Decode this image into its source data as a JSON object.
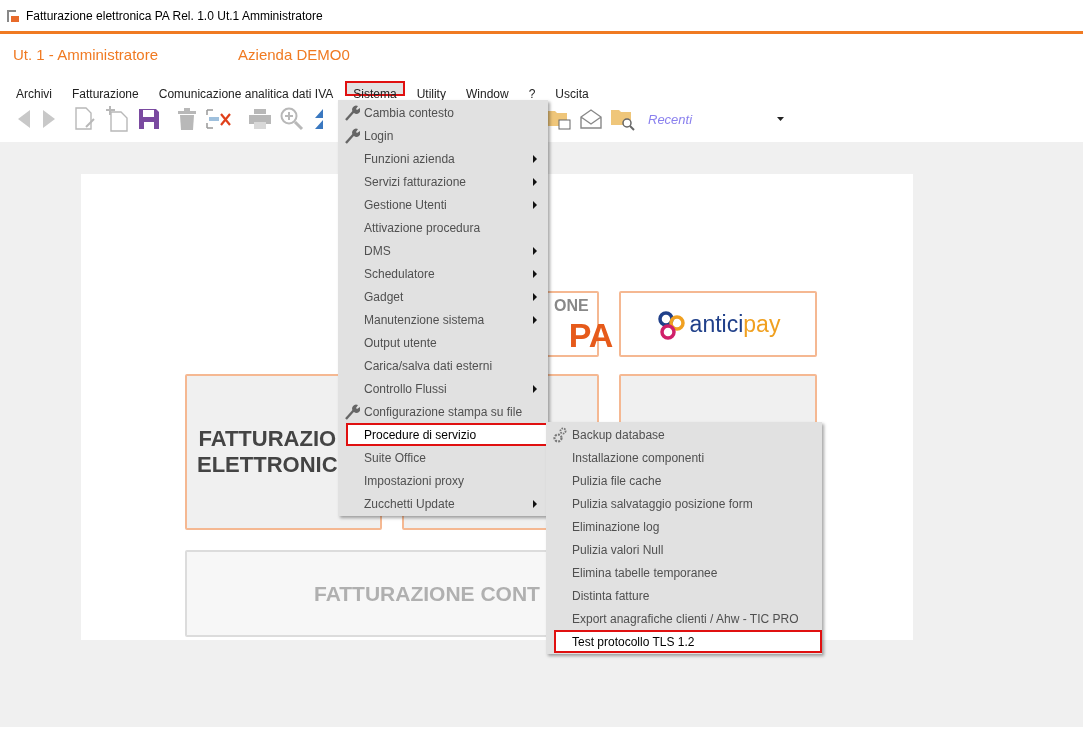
{
  "window": {
    "title": "Fatturazione elettronica PA Rel. 1.0 Ut.1 Amministratore"
  },
  "header": {
    "user": "Ut. 1 - Amministratore",
    "company": "Azienda DEMO0"
  },
  "menubar": [
    {
      "label": "Archivi",
      "selected": false
    },
    {
      "label": "Fatturazione",
      "selected": false
    },
    {
      "label": "Comunicazione analitica dati IVA",
      "selected": false
    },
    {
      "label": "Sistema",
      "selected": true
    },
    {
      "label": "Utility",
      "selected": false
    },
    {
      "label": "Window",
      "selected": false
    },
    {
      "label": "?",
      "selected": false
    },
    {
      "label": "Uscita",
      "selected": false
    }
  ],
  "toolbar": {
    "recent": {
      "placeholder": "Recenti"
    }
  },
  "tiles": [
    {
      "kind": "empty"
    },
    {
      "kind": "partial-logo",
      "lines": [
        "ONE",
        "PA"
      ]
    },
    {
      "kind": "anticipay",
      "words": [
        "antici",
        "pay"
      ]
    },
    {
      "kind": "title",
      "lines": [
        "FATTURAZIO",
        "ELETTRONIC"
      ]
    },
    {
      "kind": "blank"
    },
    {
      "kind": "blank"
    },
    {
      "kind": "wide-title",
      "lines": [
        "FATTURAZIONE CONT"
      ]
    }
  ],
  "menu": [
    {
      "label": "Cambia contesto",
      "kind": "wrench",
      "submenu": false,
      "selected": false
    },
    {
      "label": "Login",
      "kind": "wrench",
      "submenu": false,
      "selected": false
    },
    {
      "label": "Funzioni azienda",
      "kind": "plain",
      "submenu": true,
      "selected": false
    },
    {
      "label": "Servizi fatturazione",
      "kind": "plain",
      "submenu": true,
      "selected": false
    },
    {
      "label": "Gestione Utenti",
      "kind": "plain",
      "submenu": true,
      "selected": false
    },
    {
      "label": "Attivazione procedura",
      "kind": "plain",
      "submenu": false,
      "selected": false
    },
    {
      "label": "DMS",
      "kind": "plain",
      "submenu": true,
      "selected": false
    },
    {
      "label": "Schedulatore",
      "kind": "plain",
      "submenu": true,
      "selected": false
    },
    {
      "label": "Gadget",
      "kind": "plain",
      "submenu": true,
      "selected": false
    },
    {
      "label": "Manutenzione sistema",
      "kind": "plain",
      "submenu": true,
      "selected": false
    },
    {
      "label": "Output utente",
      "kind": "plain",
      "submenu": false,
      "selected": false
    },
    {
      "label": "Carica/salva dati esterni",
      "kind": "plain",
      "submenu": false,
      "selected": false
    },
    {
      "label": "Controllo Flussi",
      "kind": "plain",
      "submenu": true,
      "selected": false
    },
    {
      "label": "Configurazione stampa su file",
      "kind": "wrench",
      "submenu": false,
      "selected": false
    },
    {
      "label": "Procedure di servizio",
      "kind": "plain",
      "submenu": false,
      "selected": true
    },
    {
      "label": "Suite Office",
      "kind": "plain",
      "submenu": false,
      "selected": false
    },
    {
      "label": "Impostazioni proxy",
      "kind": "plain",
      "submenu": false,
      "selected": false
    },
    {
      "label": "Zucchetti Update",
      "kind": "plain",
      "submenu": true,
      "selected": false
    }
  ],
  "submenu": [
    {
      "label": "Backup database",
      "kind": "gear",
      "selected": false
    },
    {
      "label": "Installazione componenti",
      "kind": "plain",
      "selected": false
    },
    {
      "label": "Pulizia file cache",
      "kind": "plain",
      "selected": false
    },
    {
      "label": "Pulizia salvataggio posizione form",
      "kind": "plain",
      "selected": false
    },
    {
      "label": "Eliminazione log",
      "kind": "plain",
      "selected": false
    },
    {
      "label": "Pulizia valori Null",
      "kind": "plain",
      "selected": false
    },
    {
      "label": "Elimina tabelle temporanee",
      "kind": "plain",
      "selected": false
    },
    {
      "label": "Distinta fatture",
      "kind": "plain",
      "selected": false
    },
    {
      "label": "Export anagrafiche clienti / Ahw - TIC PRO",
      "kind": "plain",
      "selected": false
    },
    {
      "label": "Test protocollo TLS 1.2",
      "kind": "plain",
      "selected": true
    }
  ]
}
